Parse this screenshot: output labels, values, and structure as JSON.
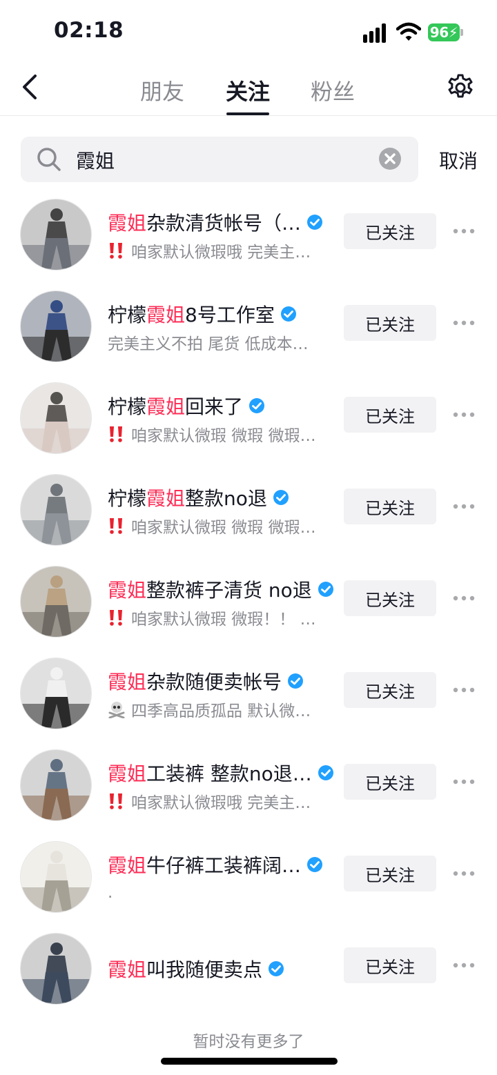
{
  "status_bar": {
    "time": "02:18",
    "battery": "96"
  },
  "header": {
    "tabs": [
      {
        "label": "朋友",
        "active": false
      },
      {
        "label": "关注",
        "active": true
      },
      {
        "label": "粉丝",
        "active": false
      }
    ]
  },
  "search": {
    "value": "霞姐",
    "cancel_label": "取消"
  },
  "users": [
    {
      "highlight_pre": "",
      "highlight": "霞姐",
      "name_rest": "杂款清货帐号（…",
      "bio_icon": "double-exclamation-icon",
      "bio": "咱家默认微瑕哦 完美主…",
      "follow_label": "已关注",
      "avatar_colors": [
        "#2b2b2b",
        "#6b6f78",
        "#c9c9c9"
      ]
    },
    {
      "highlight_pre": "柠檬",
      "highlight": "霞姐",
      "name_rest": "8号工作室",
      "bio_icon": "",
      "bio": "完美主义不拍 尾货 低成本…",
      "follow_label": "已关注",
      "avatar_colors": [
        "#1f3b7a",
        "#2c2c2c",
        "#b0b4bd"
      ]
    },
    {
      "highlight_pre": "柠檬",
      "highlight": "霞姐",
      "name_rest": "回来了",
      "bio_icon": "double-exclamation-icon",
      "bio": "咱家默认微瑕 微瑕 微瑕…",
      "follow_label": "已关注",
      "avatar_colors": [
        "#3b3836",
        "#d9c9c3",
        "#e9e6e4"
      ]
    },
    {
      "highlight_pre": "柠檬",
      "highlight": "霞姐",
      "name_rest": "整款no退",
      "bio_icon": "double-exclamation-icon",
      "bio": "咱家默认微瑕 微瑕 微瑕…",
      "follow_label": "已关注",
      "avatar_colors": [
        "#5c6369",
        "#8d9399",
        "#dadada"
      ]
    },
    {
      "highlight_pre": "",
      "highlight": "霞姐",
      "name_rest": "整款裤子清货 no退",
      "bio_icon": "double-exclamation-icon",
      "bio": "咱家默认微瑕 微瑕！！ …",
      "follow_label": "已关注",
      "avatar_colors": [
        "#b69a76",
        "#6f6a63",
        "#c7c3bb"
      ]
    },
    {
      "highlight_pre": "",
      "highlight": "霞姐",
      "name_rest": "杂款随便卖帐号",
      "bio_icon": "skull-crossbones-icon",
      "bio": "四季高品质孤品 默认微…",
      "follow_label": "已关注",
      "avatar_colors": [
        "#f4f4f4",
        "#2a2a2a",
        "#e0e0e0"
      ]
    },
    {
      "highlight_pre": "",
      "highlight": "霞姐",
      "name_rest": "工装裤 整款no退…",
      "bio_icon": "double-exclamation-icon",
      "bio": "咱家默认微瑕哦 完美主…",
      "follow_label": "已关注",
      "avatar_colors": [
        "#4a5d72",
        "#8a6a52",
        "#d5d5d5"
      ]
    },
    {
      "highlight_pre": "",
      "highlight": "霞姐",
      "name_rest": "牛仔裤工装裤阔…",
      "bio_icon": "",
      "bio": ".",
      "follow_label": "已关注",
      "avatar_colors": [
        "#e4e1da",
        "#a6a195",
        "#f1efea"
      ]
    },
    {
      "highlight_pre": "",
      "highlight": "霞姐",
      "name_rest": "叫我随便卖点",
      "bio_icon": "",
      "bio": "",
      "follow_label": "已关注",
      "avatar_colors": [
        "#1e2838",
        "#3d4a5e",
        "#d0d0d0"
      ]
    }
  ],
  "footer": {
    "no_more_text": "暂时没有更多了"
  },
  "colors": {
    "highlight": "#fe2c55",
    "verified": "#20a0ff",
    "text_secondary": "#8a8b91"
  }
}
